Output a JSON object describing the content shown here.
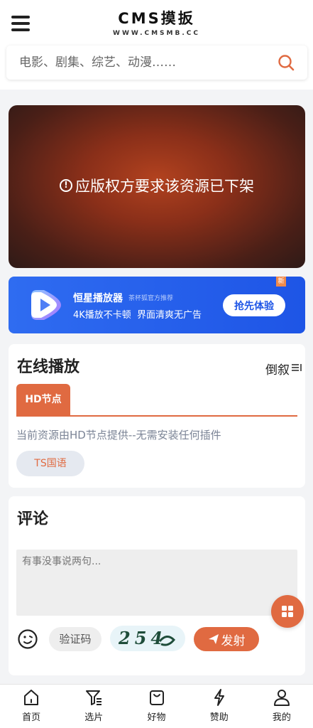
{
  "header": {
    "logo_main": "CMS摸扳",
    "logo_sub": "WWW.CMSMB.CC",
    "search_placeholder": "电影、剧集、综艺、动漫……"
  },
  "player": {
    "message": "应版权方要求该资源已下架"
  },
  "banner": {
    "title": "恒星播放器",
    "tag": "茶杯狐官方推荐",
    "subtitle": "4K播放不卡顿  界面清爽无广告",
    "button": "抢先体验",
    "badge": "新"
  },
  "play_section": {
    "title": "在线播放",
    "sort_label": "倒叙",
    "tab_label": "HD节点",
    "source_note": "当前资源由HD节点提供--无需安装任何插件",
    "episode_label": "TS国语"
  },
  "comment_section": {
    "title": "评论",
    "placeholder": "有事没事说两句...",
    "captcha_placeholder": "验证码",
    "captcha_text": "254",
    "send_label": "发射"
  },
  "bottom_nav": {
    "items": [
      {
        "label": "首页",
        "icon": "home-icon"
      },
      {
        "label": "选片",
        "icon": "filter-icon"
      },
      {
        "label": "好物",
        "icon": "shopping-bag-icon"
      },
      {
        "label": "赞助",
        "icon": "lightning-icon"
      },
      {
        "label": "我的",
        "icon": "user-icon"
      }
    ]
  },
  "colors": {
    "accent": "#e06a41",
    "banner_blue": "#1e55e6"
  }
}
